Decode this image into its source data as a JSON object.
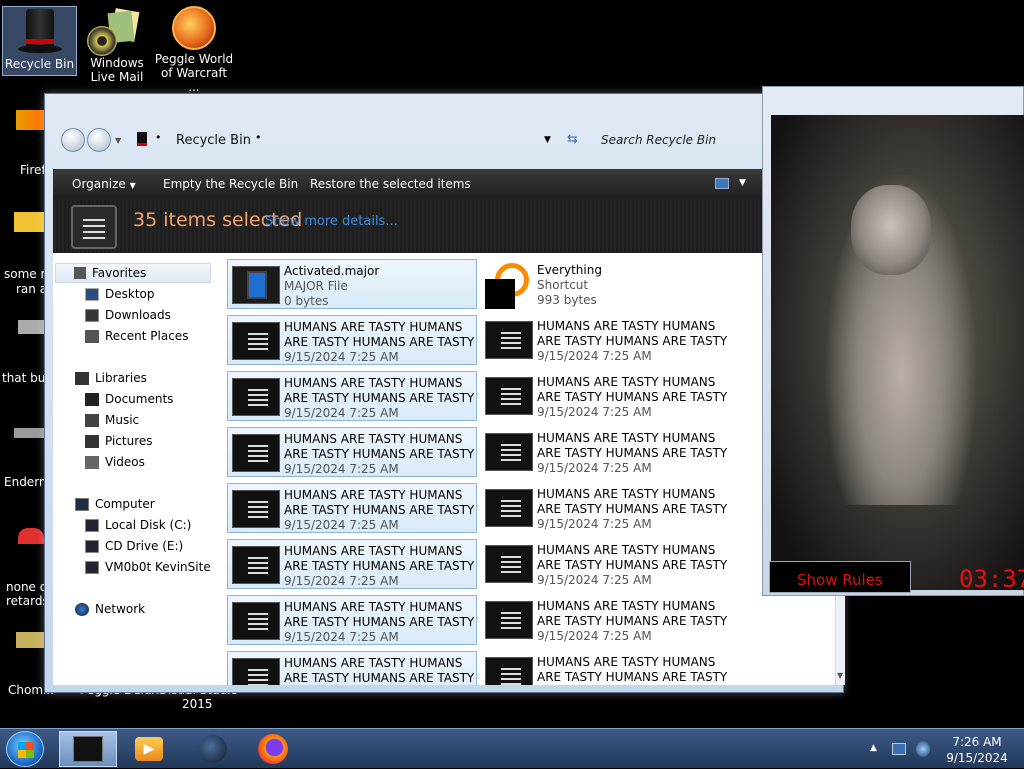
{
  "desktop": {
    "icons": [
      {
        "label": "Recycle Bin"
      },
      {
        "label": "Windows Live Mail"
      },
      {
        "label": "Peggle World of Warcraft ..."
      }
    ],
    "left_labels": [
      "Firef",
      "some ru",
      "ran a",
      "that but",
      "Enderm",
      "none o",
      "retards",
      "Chomik",
      "Peggle Deluxe",
      "Visual Studio",
      "2015"
    ]
  },
  "explorer": {
    "address": "Recycle Bin",
    "search_placeholder": "Search Recycle Bin",
    "toolbar": {
      "organize": "Organize",
      "empty": "Empty the Recycle Bin",
      "restore": "Restore the selected items"
    },
    "details": {
      "selected": "35 items selected",
      "more": "Show more details..."
    },
    "nav": {
      "favorites": "Favorites",
      "desktop": "Desktop",
      "downloads": "Downloads",
      "recent": "Recent Places",
      "libraries": "Libraries",
      "documents": "Documents",
      "music": "Music",
      "pictures": "Pictures",
      "videos": "Videos",
      "computer": "Computer",
      "local_disk": "Local Disk (C:)",
      "cd_drive": "CD Drive (E:)",
      "network_share": "VM0b0t KevinSite",
      "network": "Network"
    },
    "files": [
      {
        "name": "Activated.major",
        "line2": "MAJOR File",
        "line3": "0 bytes"
      },
      {
        "name": "Everything",
        "line2": "Shortcut",
        "line3": "993 bytes"
      },
      {
        "name": "HUMANS ARE TASTY HUMANS",
        "line2": "ARE TASTY HUMANS ARE TASTY ...",
        "line3": "9/15/2024 7:25 AM"
      },
      {
        "name": "HUMANS ARE TASTY HUMANS",
        "line2": "ARE TASTY HUMANS ARE TASTY ...",
        "line3": "9/15/2024 7:25 AM"
      },
      {
        "name": "HUMANS ARE TASTY HUMANS",
        "line2": "ARE TASTY HUMANS ARE TASTY ...",
        "line3": "9/15/2024 7:25 AM"
      },
      {
        "name": "HUMANS ARE TASTY HUMANS",
        "line2": "ARE TASTY HUMANS ARE TASTY ...",
        "line3": "9/15/2024 7:25 AM"
      },
      {
        "name": "HUMANS ARE TASTY HUMANS",
        "line2": "ARE TASTY HUMANS ARE TASTY ...",
        "line3": "9/15/2024 7:25 AM"
      },
      {
        "name": "HUMANS ARE TASTY HUMANS",
        "line2": "ARE TASTY HUMANS ARE TASTY ...",
        "line3": "9/15/2024 7:25 AM"
      },
      {
        "name": "HUMANS ARE TASTY HUMANS",
        "line2": "ARE TASTY HUMANS ARE TASTY ...",
        "line3": "9/15/2024 7:25 AM"
      },
      {
        "name": "HUMANS ARE TASTY HUMANS",
        "line2": "ARE TASTY HUMANS ARE TASTY ...",
        "line3": "9/15/2024 7:25 AM"
      },
      {
        "name": "HUMANS ARE TASTY HUMANS",
        "line2": "ARE TASTY HUMANS ARE TASTY ...",
        "line3": "9/15/2024 7:25 AM"
      },
      {
        "name": "HUMANS ARE TASTY HUMANS",
        "line2": "ARE TASTY HUMANS ARE TASTY ...",
        "line3": "9/15/2024 7:25 AM"
      },
      {
        "name": "HUMANS ARE TASTY HUMANS",
        "line2": "ARE TASTY HUMANS ARE TASTY ...",
        "line3": "9/15/2024 7:25 AM"
      },
      {
        "name": "HUMANS ARE TASTY HUMANS",
        "line2": "ARE TASTY HUMANS ARE TASTY ...",
        "line3": "9/15/2024 7:25 AM"
      },
      {
        "name": "HUMANS ARE TASTY HUMANS",
        "line2": "ARE TASTY HUMANS ARE TASTY ..."
      },
      {
        "name": "HUMANS ARE TASTY HUMANS",
        "line2": "ARE TASTY HUMANS ARE TASTY ..."
      }
    ]
  },
  "video_window": {
    "show_rules": "Show Rules",
    "timer": "03:37"
  },
  "taskbar": {
    "time": "7:26 AM",
    "date": "9/15/2024"
  },
  "colors": {
    "selected_text": "#f5a36a",
    "link": "#3a8ee6",
    "timer": "#e81010"
  }
}
